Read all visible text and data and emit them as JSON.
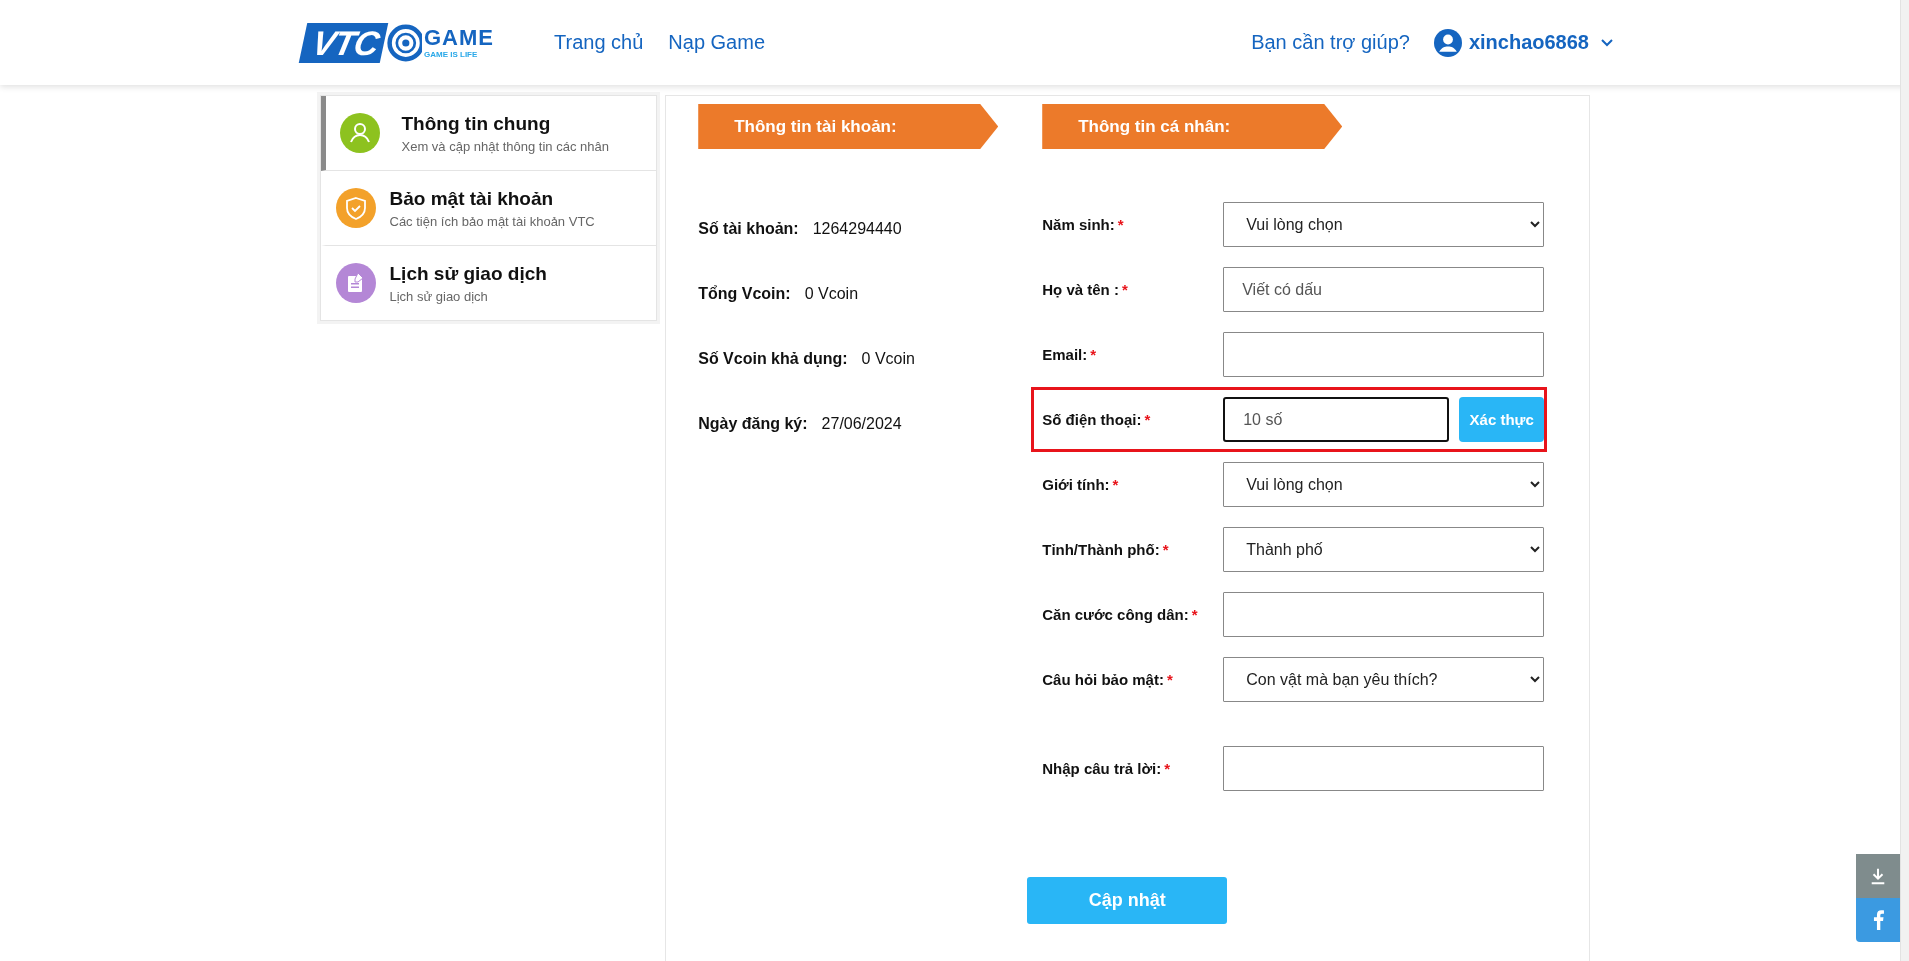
{
  "header": {
    "logo": {
      "mark": "VTC",
      "word": "GAME",
      "tagline": "GAME IS LIFE"
    },
    "nav": [
      {
        "label": "Trang chủ"
      },
      {
        "label": "Nạp Game"
      }
    ],
    "help": "Bạn cần trợ giúp?",
    "username": "xinchao6868"
  },
  "sidebar": {
    "items": [
      {
        "title": "Thông tin chung",
        "subtitle": "Xem và cập nhật thông tin các nhân",
        "kind": "user",
        "color": "#8dc21f",
        "selected": true
      },
      {
        "title": "Bảo mật tài khoản",
        "subtitle": "Các tiện ích bảo mật tài khoản VTC",
        "kind": "shield",
        "color": "#f3a12a",
        "selected": false
      },
      {
        "title": "Lịch sử giao dịch",
        "subtitle": "Lịch sử giao dịch",
        "kind": "edit",
        "color": "#b487d6",
        "selected": false
      }
    ]
  },
  "account": {
    "title": "Thông tin tài khoản:",
    "rows": [
      {
        "label": "Số tài khoản:",
        "value": "1264294440"
      },
      {
        "label": "Tổng Vcoin:",
        "value": "0 Vcoin"
      },
      {
        "label": "Số Vcoin khả dụng:",
        "value": "0 Vcoin"
      },
      {
        "label": "Ngày đăng ký:",
        "value": "27/06/2024"
      }
    ]
  },
  "personal": {
    "title": "Thông tin cá nhân:",
    "fields": [
      {
        "label": "Năm sinh:",
        "mark": "*",
        "kind": "select",
        "value": "Vui lòng chọn",
        "highlighted": false,
        "focused": false
      },
      {
        "label": "Họ và tên :",
        "mark": "*",
        "kind": "input",
        "placeholder": "Viết có dấu",
        "highlighted": false,
        "focused": false
      },
      {
        "label": "Email:",
        "mark": "*",
        "kind": "input",
        "highlighted": false,
        "focused": false
      },
      {
        "label": "Số điện thoại:",
        "mark": "*",
        "kind": "input_button",
        "placeholder": "10 số",
        "button": "Xác thực",
        "highlighted": true,
        "focused": true
      },
      {
        "label": "Giới tính:",
        "mark": "*",
        "kind": "select",
        "value": "Vui lòng chọn",
        "highlighted": false,
        "focused": false
      },
      {
        "label": "Tỉnh/Thành phố:",
        "mark": "*",
        "kind": "select",
        "value": "Thành phố",
        "highlighted": false,
        "focused": false
      },
      {
        "label": "Căn cước công dân:",
        "mark": "*",
        "kind": "input",
        "highlighted": false,
        "focused": false
      },
      {
        "label": "Câu hỏi bảo mật:",
        "mark": "*",
        "kind": "select",
        "value": "Con vật mà bạn yêu thích?",
        "highlighted": false,
        "focused": false
      },
      {
        "label": "Nhập câu trả lời:",
        "mark": "*",
        "kind": "input",
        "highlighted": false,
        "focused": false
      }
    ],
    "submit": "Cập nhật"
  }
}
